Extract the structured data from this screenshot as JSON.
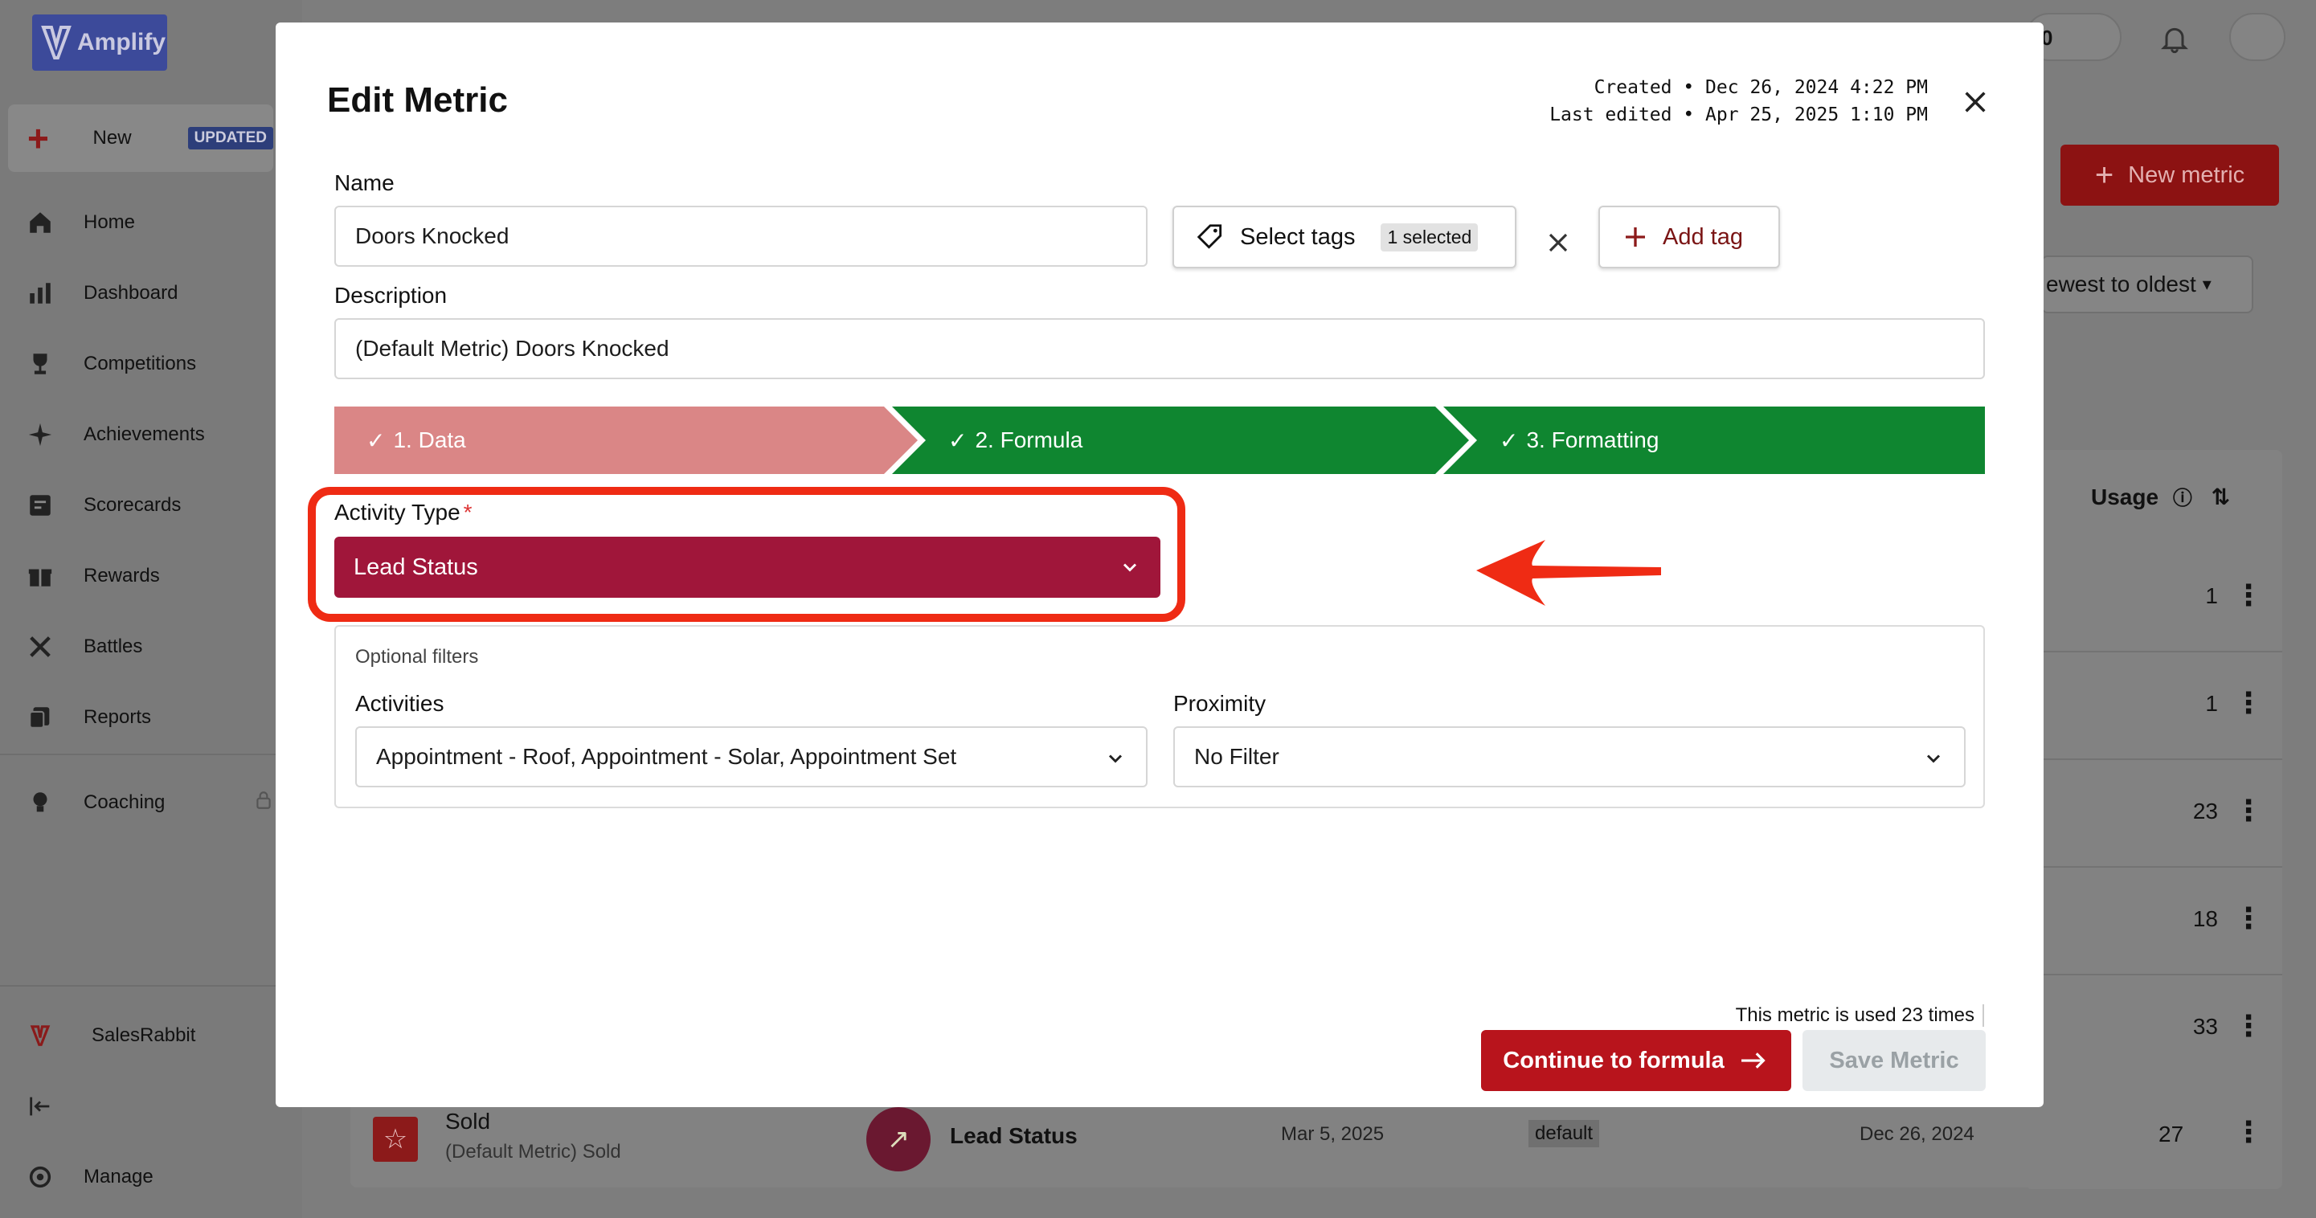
{
  "app": {
    "brand": "Amplify",
    "new_label": "New",
    "updated_badge": "UPDATED",
    "nav": [
      {
        "label": "Home",
        "icon": "home-icon"
      },
      {
        "label": "Dashboard",
        "icon": "bar-chart-icon"
      },
      {
        "label": "Competitions",
        "icon": "trophy-icon"
      },
      {
        "label": "Achievements",
        "icon": "sparkle-icon"
      },
      {
        "label": "Scorecards",
        "icon": "scorecard-icon"
      },
      {
        "label": "Rewards",
        "icon": "gift-icon"
      },
      {
        "label": "Battles",
        "icon": "swords-icon"
      },
      {
        "label": "Reports",
        "icon": "reports-icon"
      },
      {
        "label": "Coaching",
        "icon": "lightbulb-icon"
      }
    ],
    "org_name": "SalesRabbit",
    "manage_label": "Manage",
    "notification_count": "0"
  },
  "background": {
    "new_metric_button": "New metric",
    "sort_label": "ewest to oldest",
    "usage_header": "Usage",
    "usage_values": [
      "1",
      "1",
      "23",
      "18",
      "33",
      "27"
    ],
    "bottom_row": {
      "name": "Sold",
      "description": "(Default Metric) Sold",
      "type": "Lead Status",
      "created": "Mar 5, 2025",
      "tag": "default",
      "edited": "Dec 26, 2024"
    }
  },
  "modal": {
    "title": "Edit Metric",
    "created_line": "Created • Dec 26, 2024 4:22 PM",
    "edited_line": "Last edited • Apr 25, 2025 1:10 PM",
    "name_label": "Name",
    "name_value": "Doors Knocked",
    "select_tags_label": "Select tags",
    "selected_count": "1 selected",
    "add_tag_label": "Add tag",
    "description_label": "Description",
    "description_value": "(Default Metric) Doors Knocked",
    "steps": [
      {
        "label": "1. Data",
        "color": "#da8686"
      },
      {
        "label": "2. Formula",
        "color": "#0f8630"
      },
      {
        "label": "3. Formatting",
        "color": "#0f8630"
      }
    ],
    "activity_type_label": "Activity Type",
    "required_mark": "*",
    "activity_type_value": "Lead Status",
    "optional_filters_label": "Optional filters",
    "activities_label": "Activities",
    "activities_value": "Appointment - Roof, Appointment - Solar, Appointment Set",
    "proximity_label": "Proximity",
    "proximity_value": "No Filter",
    "usage_note": "This metric is used 23 times",
    "continue_button": "Continue to formula",
    "save_button": "Save Metric"
  },
  "colors": {
    "primary": "#b8141c",
    "activity_select": "#a0163a",
    "highlight": "#ef2b14",
    "step_done": "#0f8630",
    "step_current": "#da8686"
  }
}
